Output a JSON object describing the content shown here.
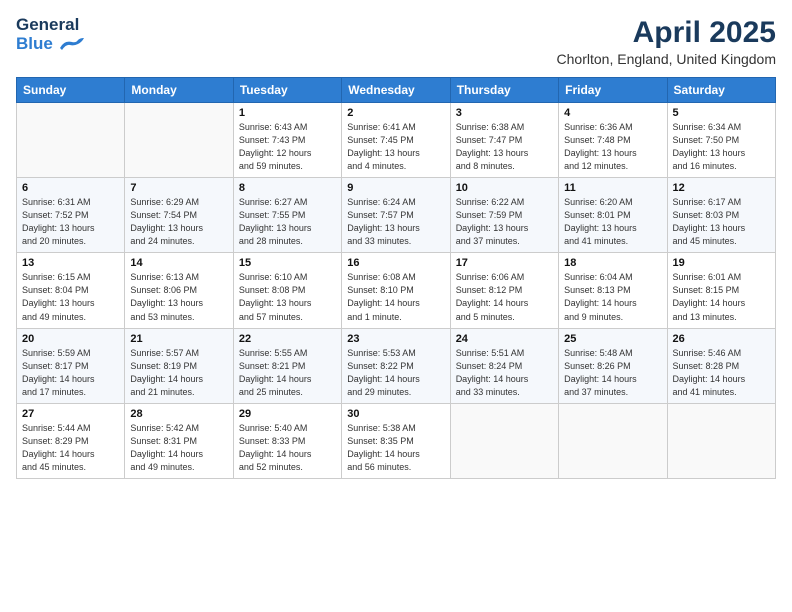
{
  "header": {
    "logo_line1": "General",
    "logo_line2": "Blue",
    "month": "April 2025",
    "location": "Chorlton, England, United Kingdom"
  },
  "weekdays": [
    "Sunday",
    "Monday",
    "Tuesday",
    "Wednesday",
    "Thursday",
    "Friday",
    "Saturday"
  ],
  "weeks": [
    [
      {
        "day": "",
        "info": ""
      },
      {
        "day": "",
        "info": ""
      },
      {
        "day": "1",
        "info": "Sunrise: 6:43 AM\nSunset: 7:43 PM\nDaylight: 12 hours\nand 59 minutes."
      },
      {
        "day": "2",
        "info": "Sunrise: 6:41 AM\nSunset: 7:45 PM\nDaylight: 13 hours\nand 4 minutes."
      },
      {
        "day": "3",
        "info": "Sunrise: 6:38 AM\nSunset: 7:47 PM\nDaylight: 13 hours\nand 8 minutes."
      },
      {
        "day": "4",
        "info": "Sunrise: 6:36 AM\nSunset: 7:48 PM\nDaylight: 13 hours\nand 12 minutes."
      },
      {
        "day": "5",
        "info": "Sunrise: 6:34 AM\nSunset: 7:50 PM\nDaylight: 13 hours\nand 16 minutes."
      }
    ],
    [
      {
        "day": "6",
        "info": "Sunrise: 6:31 AM\nSunset: 7:52 PM\nDaylight: 13 hours\nand 20 minutes."
      },
      {
        "day": "7",
        "info": "Sunrise: 6:29 AM\nSunset: 7:54 PM\nDaylight: 13 hours\nand 24 minutes."
      },
      {
        "day": "8",
        "info": "Sunrise: 6:27 AM\nSunset: 7:55 PM\nDaylight: 13 hours\nand 28 minutes."
      },
      {
        "day": "9",
        "info": "Sunrise: 6:24 AM\nSunset: 7:57 PM\nDaylight: 13 hours\nand 33 minutes."
      },
      {
        "day": "10",
        "info": "Sunrise: 6:22 AM\nSunset: 7:59 PM\nDaylight: 13 hours\nand 37 minutes."
      },
      {
        "day": "11",
        "info": "Sunrise: 6:20 AM\nSunset: 8:01 PM\nDaylight: 13 hours\nand 41 minutes."
      },
      {
        "day": "12",
        "info": "Sunrise: 6:17 AM\nSunset: 8:03 PM\nDaylight: 13 hours\nand 45 minutes."
      }
    ],
    [
      {
        "day": "13",
        "info": "Sunrise: 6:15 AM\nSunset: 8:04 PM\nDaylight: 13 hours\nand 49 minutes."
      },
      {
        "day": "14",
        "info": "Sunrise: 6:13 AM\nSunset: 8:06 PM\nDaylight: 13 hours\nand 53 minutes."
      },
      {
        "day": "15",
        "info": "Sunrise: 6:10 AM\nSunset: 8:08 PM\nDaylight: 13 hours\nand 57 minutes."
      },
      {
        "day": "16",
        "info": "Sunrise: 6:08 AM\nSunset: 8:10 PM\nDaylight: 14 hours\nand 1 minute."
      },
      {
        "day": "17",
        "info": "Sunrise: 6:06 AM\nSunset: 8:12 PM\nDaylight: 14 hours\nand 5 minutes."
      },
      {
        "day": "18",
        "info": "Sunrise: 6:04 AM\nSunset: 8:13 PM\nDaylight: 14 hours\nand 9 minutes."
      },
      {
        "day": "19",
        "info": "Sunrise: 6:01 AM\nSunset: 8:15 PM\nDaylight: 14 hours\nand 13 minutes."
      }
    ],
    [
      {
        "day": "20",
        "info": "Sunrise: 5:59 AM\nSunset: 8:17 PM\nDaylight: 14 hours\nand 17 minutes."
      },
      {
        "day": "21",
        "info": "Sunrise: 5:57 AM\nSunset: 8:19 PM\nDaylight: 14 hours\nand 21 minutes."
      },
      {
        "day": "22",
        "info": "Sunrise: 5:55 AM\nSunset: 8:21 PM\nDaylight: 14 hours\nand 25 minutes."
      },
      {
        "day": "23",
        "info": "Sunrise: 5:53 AM\nSunset: 8:22 PM\nDaylight: 14 hours\nand 29 minutes."
      },
      {
        "day": "24",
        "info": "Sunrise: 5:51 AM\nSunset: 8:24 PM\nDaylight: 14 hours\nand 33 minutes."
      },
      {
        "day": "25",
        "info": "Sunrise: 5:48 AM\nSunset: 8:26 PM\nDaylight: 14 hours\nand 37 minutes."
      },
      {
        "day": "26",
        "info": "Sunrise: 5:46 AM\nSunset: 8:28 PM\nDaylight: 14 hours\nand 41 minutes."
      }
    ],
    [
      {
        "day": "27",
        "info": "Sunrise: 5:44 AM\nSunset: 8:29 PM\nDaylight: 14 hours\nand 45 minutes."
      },
      {
        "day": "28",
        "info": "Sunrise: 5:42 AM\nSunset: 8:31 PM\nDaylight: 14 hours\nand 49 minutes."
      },
      {
        "day": "29",
        "info": "Sunrise: 5:40 AM\nSunset: 8:33 PM\nDaylight: 14 hours\nand 52 minutes."
      },
      {
        "day": "30",
        "info": "Sunrise: 5:38 AM\nSunset: 8:35 PM\nDaylight: 14 hours\nand 56 minutes."
      },
      {
        "day": "",
        "info": ""
      },
      {
        "day": "",
        "info": ""
      },
      {
        "day": "",
        "info": ""
      }
    ]
  ]
}
